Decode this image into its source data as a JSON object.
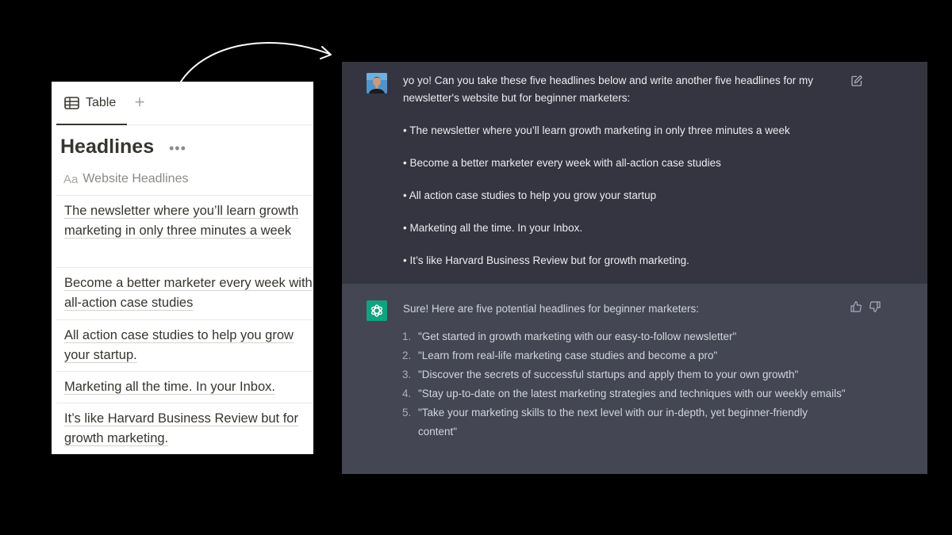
{
  "notion": {
    "view_tab_label": "Table",
    "view_tab_icon": "table-icon",
    "add_view_icon": "plus-icon",
    "title": "Headlines",
    "more_icon": "ellipsis-icon",
    "column": {
      "type_glyph": "Aa",
      "name": "Website Headlines"
    },
    "rows": [
      "The newsletter where you’ll learn growth marketing in only three minutes a week",
      "Become a better marketer every week with all-action case studies",
      "All action case studies to help you grow your startup.",
      "Marketing all the time. In your Inbox.",
      "It’s like Harvard Business Review but for growth marketing."
    ]
  },
  "chat": {
    "user": {
      "avatar_icon": "user-avatar",
      "edit_icon": "edit-icon",
      "prompt": "yo yo! Can you take these five headlines below and write another five headlines for my newsletter's website but for beginner marketers:",
      "bullets": [
        "• The newsletter where you’ll learn growth marketing in only three minutes a week",
        "• Become a better marketer every week with all-action case studies",
        "• All action case studies to help you grow your startup",
        "• Marketing all the time. In your Inbox.",
        "• It’s like Harvard Business Review but for growth marketing."
      ]
    },
    "assistant": {
      "avatar_icon": "openai-logo-icon",
      "thumbs_up_icon": "thumbs-up-icon",
      "thumbs_down_icon": "thumbs-down-icon",
      "intro": "Sure! Here are five potential headlines for beginner marketers:",
      "items": [
        {
          "num": "1.",
          "text": "\"Get started in growth marketing with our easy-to-follow newsletter\""
        },
        {
          "num": "2.",
          "text": "\"Learn from real-life marketing case studies and become a pro\""
        },
        {
          "num": "3.",
          "text": "\"Discover the secrets of successful startups and apply them to your own growth\""
        },
        {
          "num": "4.",
          "text": "\"Stay up-to-date on the latest marketing strategies and techniques with our weekly emails\""
        },
        {
          "num": "5.",
          "text": "\"Take your marketing skills to the next level with our in-depth, yet beginner-friendly content\""
        }
      ]
    }
  },
  "colors": {
    "background": "#000000",
    "user_bg": "#343541",
    "assistant_bg": "#444654",
    "openai_green": "#10a37f"
  }
}
